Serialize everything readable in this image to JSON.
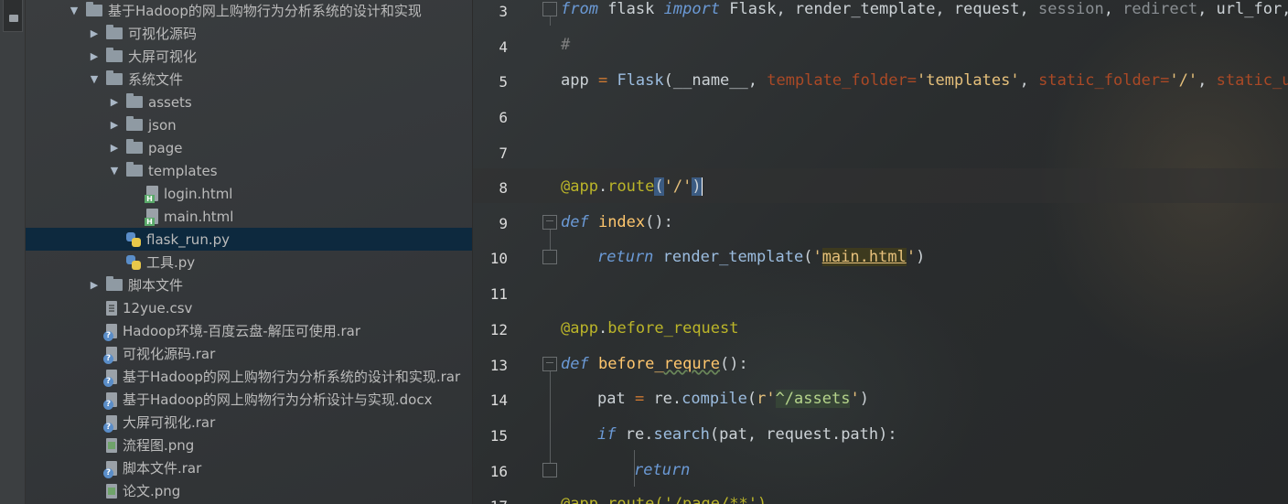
{
  "toolstrip": {
    "tab_number": "1"
  },
  "project_tree": {
    "rows": [
      {
        "label": "基于Hadoop的网上购物行为分析系统的设计和实现",
        "type": "folder",
        "depth": 0,
        "expanded": true
      },
      {
        "label": "可视化源码",
        "type": "folder",
        "depth": 1,
        "expanded": false
      },
      {
        "label": "大屏可视化",
        "type": "folder",
        "depth": 1,
        "expanded": false
      },
      {
        "label": "系统文件",
        "type": "folder",
        "depth": 1,
        "expanded": true
      },
      {
        "label": "assets",
        "type": "folder",
        "depth": 2,
        "expanded": false
      },
      {
        "label": "json",
        "type": "folder",
        "depth": 2,
        "expanded": false
      },
      {
        "label": "page",
        "type": "folder",
        "depth": 2,
        "expanded": false
      },
      {
        "label": "templates",
        "type": "folder",
        "depth": 2,
        "expanded": true
      },
      {
        "label": "login.html",
        "type": "html",
        "depth": 3
      },
      {
        "label": "main.html",
        "type": "html",
        "depth": 3
      },
      {
        "label": "flask_run.py",
        "type": "python",
        "depth": 2,
        "selected": true
      },
      {
        "label": "工具.py",
        "type": "python",
        "depth": 2
      },
      {
        "label": "脚本文件",
        "type": "folder",
        "depth": 1,
        "expanded": false
      },
      {
        "label": "12yue.csv",
        "type": "text",
        "depth": 1
      },
      {
        "label": "Hadoop环境-百度云盘-解压可使用.rar",
        "type": "unknown",
        "depth": 1
      },
      {
        "label": "可视化源码.rar",
        "type": "unknown",
        "depth": 1
      },
      {
        "label": "基于Hadoop的网上购物行为分析系统的设计和实现.rar",
        "type": "unknown",
        "depth": 1
      },
      {
        "label": "基于Hadoop的网上购物行为分析设计与实现.docx",
        "type": "unknown",
        "depth": 1
      },
      {
        "label": "大屏可视化.rar",
        "type": "unknown",
        "depth": 1
      },
      {
        "label": "流程图.png",
        "type": "image",
        "depth": 1
      },
      {
        "label": "脚本文件.rar",
        "type": "unknown",
        "depth": 1
      },
      {
        "label": "论文.png",
        "type": "image",
        "depth": 1
      }
    ]
  },
  "editor": {
    "line_numbers": [
      "3",
      "4",
      "5",
      "6",
      "7",
      "8",
      "9",
      "10",
      "11",
      "12",
      "13",
      "14",
      "15",
      "16",
      "17"
    ],
    "l3": {
      "from": "from",
      "mod": " flask ",
      "import": "import",
      "names": " Flask, render_template, request, ",
      "dim1": "session",
      "c1": ", ",
      "dim2": "redirect",
      "c2": ", url_for, s"
    },
    "l4": {
      "comment": "#"
    },
    "l5": {
      "a": "app ",
      "eq": "=",
      "sp": " ",
      "cls": "Flask",
      "p1": "(__name__, ",
      "k1": "template_folder",
      "e1": "=",
      "s1": "'templates'",
      "c1": ", ",
      "k2": "static_folder",
      "e2": "=",
      "s2": "'/'",
      "c2": ", ",
      "k3": "static_url"
    },
    "l8": {
      "dec": "@app",
      "dot": ".",
      "route": "route",
      "p_open": "(",
      "s": "'/'",
      "p_close": ")"
    },
    "l9": {
      "def": "def",
      "name": " index",
      "sig": "():"
    },
    "l10": {
      "ret": "return",
      "fn": " render_template",
      "p_open": "(",
      "q1": "'",
      "link": "main.html",
      "q2": "'",
      "p_close": ")"
    },
    "l12": {
      "dec": "@app",
      "dot": ".",
      "name": "before_request"
    },
    "l13": {
      "def": "def",
      "name_a": " before_",
      "name_b": "requre",
      "sig": "():"
    },
    "l14": {
      "a": "pat ",
      "eq": "=",
      "b": " re",
      "dot": ".",
      "fn": "compile",
      "p_open": "(",
      "r": "r'",
      "rx": "^/assets",
      "q": "'",
      "p_close": ")"
    },
    "l15": {
      "if": "if",
      "b": " re",
      "dot": ".",
      "fn": "search",
      "args": "(pat, request",
      "dot2": ".",
      "path": "path",
      "close": "):"
    },
    "l16": {
      "ret": "return"
    },
    "l17": {
      "partial": "@app.route('/page/**')"
    }
  }
}
